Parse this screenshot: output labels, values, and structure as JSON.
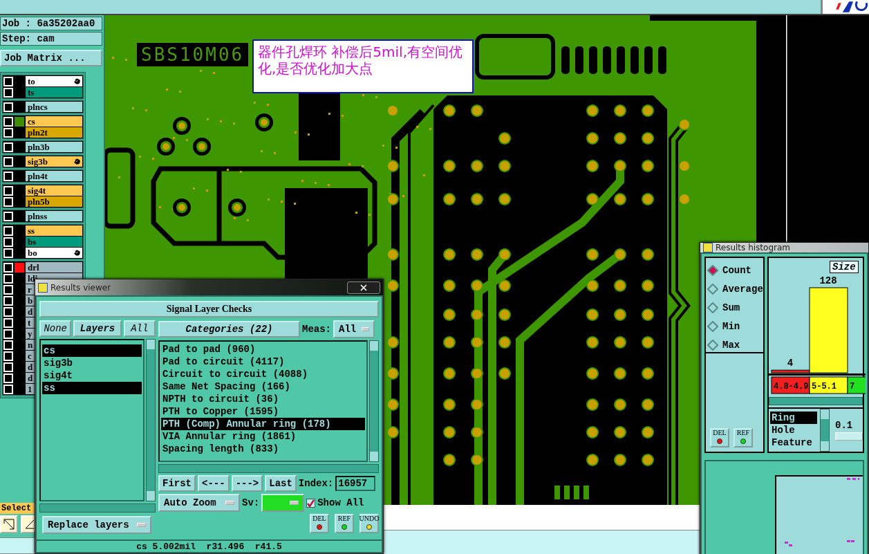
{
  "job_info": {
    "job": "Job : 6a35202aa0",
    "step": "Step: cam"
  },
  "job_matrix_button": "Job Matrix ...",
  "layer_groups": [
    {
      "layers": [
        {
          "name": "to",
          "color": "#ffffff",
          "checked": false,
          "marked": true
        },
        {
          "name": "ts",
          "color": "#009a7c",
          "checked": false,
          "marked": false
        }
      ]
    },
    {
      "layers": [
        {
          "name": "plncs",
          "color": "#9edcdc",
          "checked": false,
          "marked": false
        }
      ]
    },
    {
      "layers": [
        {
          "name": "cs",
          "color": "#ffc850",
          "checked": false,
          "marked": false,
          "swatch": {
            "color": "#3d8f00"
          }
        },
        {
          "name": "pln2t",
          "color": "#d8a800",
          "checked": false,
          "marked": false
        }
      ]
    },
    {
      "layers": [
        {
          "name": "pln3b",
          "color": "#9edcdc",
          "checked": false,
          "marked": false
        }
      ]
    },
    {
      "layers": [
        {
          "name": "sig3b",
          "color": "#ffc850",
          "checked": false,
          "marked": true
        }
      ]
    },
    {
      "layers": [
        {
          "name": "pln4t",
          "color": "#9edcdc",
          "checked": false,
          "marked": false
        }
      ]
    },
    {
      "layers": [
        {
          "name": "sig4t",
          "color": "#ffc850",
          "checked": false,
          "marked": false
        },
        {
          "name": "pln5b",
          "color": "#d8a800",
          "checked": false,
          "marked": false
        }
      ]
    },
    {
      "layers": [
        {
          "name": "plnss",
          "color": "#9edcdc",
          "checked": false,
          "marked": false
        }
      ]
    },
    {
      "layers": [
        {
          "name": "ss",
          "color": "#ffc850",
          "checked": false,
          "marked": false
        },
        {
          "name": "bs",
          "color": "#009a7c",
          "checked": false,
          "marked": false
        },
        {
          "name": "bo",
          "color": "#ffffff",
          "checked": false,
          "marked": true
        }
      ]
    },
    {
      "layers": [
        {
          "name": "drl",
          "color": "#a0b8c0",
          "checked": false,
          "marked": false,
          "swatch": {
            "color": "#ff1010"
          }
        },
        {
          "name": "ldi",
          "color": "#a0b8c0",
          "checked": false,
          "marked": false
        },
        {
          "name": "r",
          "color": "#a0b8c0",
          "checked": false
        },
        {
          "name": "b",
          "color": "#a0b8c0",
          "checked": false
        },
        {
          "name": "d",
          "color": "#a0b8c0",
          "checked": false
        },
        {
          "name": "t",
          "color": "#a0b8c0",
          "checked": false
        },
        {
          "name": "y",
          "color": "#a0b8c0",
          "checked": false
        },
        {
          "name": "n",
          "color": "#a0b8c0",
          "checked": false
        },
        {
          "name": "c",
          "color": "#a0b8c0",
          "checked": false
        },
        {
          "name": "d",
          "color": "#a0b8c0",
          "checked": false
        },
        {
          "name": "d",
          "color": "#a0b8c0",
          "checked": false
        },
        {
          "name": "1",
          "color": "#a0b8c0",
          "checked": false
        }
      ]
    }
  ],
  "select_label": "Select",
  "board": {
    "silkscreen_text": "SBS10M06",
    "note": "器件孔焊环 补偿后5mil,有空间优化,是否优化加大点"
  },
  "results_viewer": {
    "title": "Results viewer",
    "heading": "Signal Layer Checks",
    "layer_buttons": [
      {
        "label": "None",
        "kind": "option"
      },
      {
        "label": "Layers",
        "kind": "title"
      },
      {
        "label": "All",
        "kind": "option"
      }
    ],
    "layers": [
      {
        "name": "cs",
        "selected": true
      },
      {
        "name": "sig3b",
        "selected": false
      },
      {
        "name": "sig4t",
        "selected": false
      },
      {
        "name": "ss",
        "selected": true
      }
    ],
    "categories_button": "Categories (22)",
    "meas_label": "Meas:",
    "meas_value": "All",
    "categories": [
      {
        "label": "Pad to pad (960)",
        "selected": false
      },
      {
        "label": "Pad to circuit (4117)",
        "selected": false
      },
      {
        "label": "Circuit to circuit (4088)",
        "selected": false
      },
      {
        "label": "Same Net Spacing (166)",
        "selected": false
      },
      {
        "label": "NPTH to circuit (36)",
        "selected": false
      },
      {
        "label": "PTH to Copper (1595)",
        "selected": false
      },
      {
        "label": "PTH (Comp) Annular ring (178)",
        "selected": true
      },
      {
        "label": "VIA Annular ring (1861)",
        "selected": false
      },
      {
        "label": "Spacing length (833)",
        "selected": false
      }
    ],
    "nav_buttons": [
      "First",
      "<---",
      "--->",
      "Last"
    ],
    "index_label": "Index:",
    "index_value": "16957",
    "zoom_mode": "Auto Zoom",
    "sv_label": "Sv:",
    "show_all": {
      "label": "Show All",
      "checked": true
    },
    "replace_mode": "Replace layers",
    "action_buttons": [
      {
        "label": "DEL",
        "kind": "del"
      },
      {
        "label": "REF",
        "kind": "ref"
      },
      {
        "label": "UNDO",
        "kind": "undo"
      }
    ],
    "status": "cs 5.002mil  r31.496  r41.5"
  },
  "results_histogram": {
    "title": "Results histogram",
    "modes": [
      {
        "label": "Count",
        "selected": true
      },
      {
        "label": "Average",
        "selected": false
      },
      {
        "label": "Sum",
        "selected": false
      },
      {
        "label": "Min",
        "selected": false
      },
      {
        "label": "Max",
        "selected": false
      }
    ],
    "buttons": [
      {
        "label": "DEL",
        "kind": "del"
      },
      {
        "label": "REF",
        "kind": "ref"
      }
    ],
    "size_label": "Size",
    "chart_data": {
      "type": "bar",
      "categories": [
        "4.8-4.9",
        "5-5.1",
        "7"
      ],
      "colors": [
        "#f02020",
        "#ffff20",
        "#20e020"
      ],
      "series": [
        {
          "values": [
            4,
            128,
            null
          ]
        }
      ],
      "data_labels": true
    },
    "fields": [
      {
        "label": "Ring",
        "selected": true
      },
      {
        "label": "Hole",
        "selected": false
      },
      {
        "label": "Feature",
        "selected": false
      }
    ],
    "step_value": "0.1"
  }
}
